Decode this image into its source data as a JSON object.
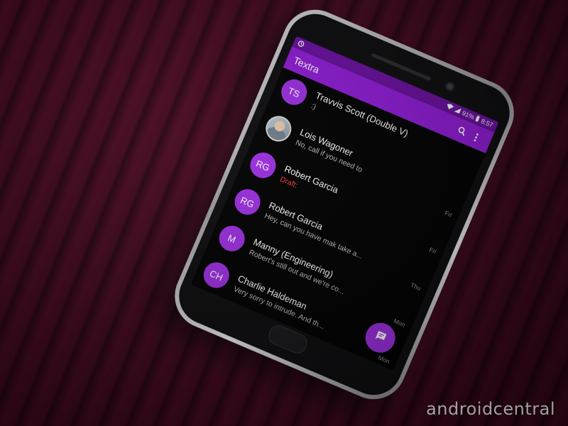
{
  "status_bar": {
    "battery": "91%",
    "time": "8:57"
  },
  "app_bar": {
    "title": "Textra",
    "search_icon": "search-icon",
    "menu_icon": "more-vert-icon"
  },
  "conversations": [
    {
      "avatar": "TS",
      "name": "Travvis Scott (Double V)",
      "snippet": ":)",
      "time": "",
      "draft": ""
    },
    {
      "avatar": "",
      "name": "Lois Wagoner",
      "snippet": "No, call if you need to",
      "time": "Fri",
      "draft": ""
    },
    {
      "avatar": "RG",
      "name": "Robert Garcia",
      "snippet": "",
      "time": "Fri",
      "draft": "Draft:"
    },
    {
      "avatar": "RG",
      "name": "Robert Garcia",
      "snippet": "Hey, can you have mak take a...",
      "time": "Thu",
      "draft": ""
    },
    {
      "avatar": "M",
      "name": "Manny (Engineering)",
      "snippet": "Robert's still out and we're co...",
      "time": "Mon",
      "draft": ""
    },
    {
      "avatar": "CH",
      "name": "Charlie Haldeman",
      "snippet": "Very sorry to intrude. And th...",
      "time": "Mon",
      "draft": ""
    }
  ],
  "fab": {
    "icon": "new-message-icon"
  },
  "watermark": "androidcentral",
  "colors": {
    "accent": "#9b2ee0",
    "app_bar": "#8f1bd6",
    "status_bar": "#6a0fa0",
    "draft": "#ff3b3b",
    "background": "#000000"
  }
}
